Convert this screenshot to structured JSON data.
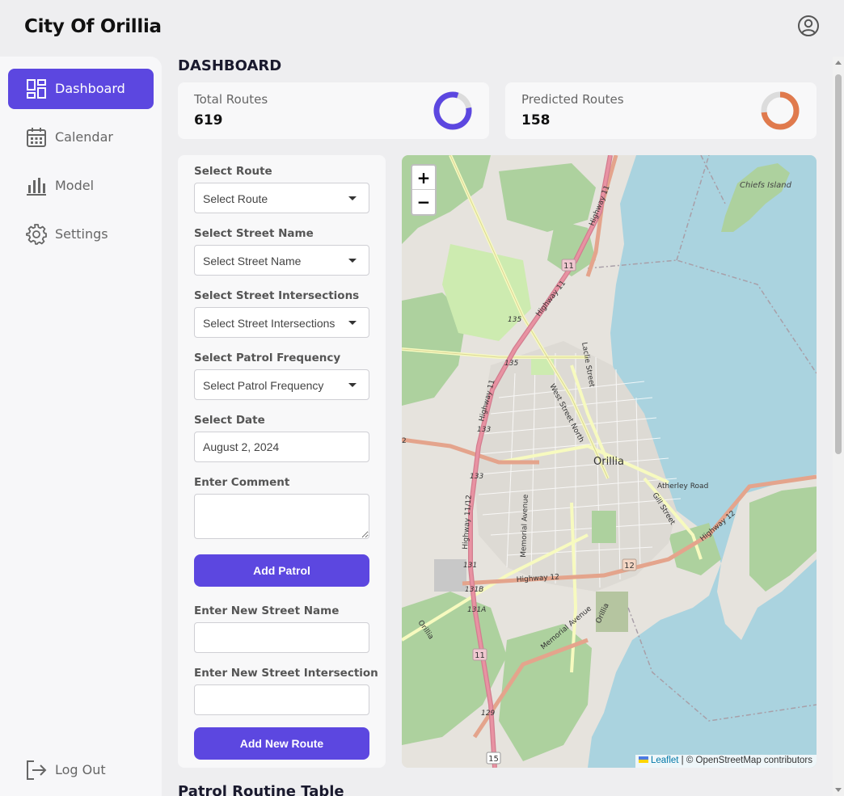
{
  "app": {
    "title": "City Of Orillia"
  },
  "header": {
    "profile_icon": "user-circle-icon"
  },
  "sidebar": {
    "items": [
      {
        "label": "Dashboard",
        "icon": "dashboard-icon",
        "active": true
      },
      {
        "label": "Calendar",
        "icon": "calendar-icon",
        "active": false
      },
      {
        "label": "Model",
        "icon": "bar-chart-icon",
        "active": false
      },
      {
        "label": "Settings",
        "icon": "gear-icon",
        "active": false
      }
    ],
    "logout": {
      "label": "Log Out",
      "icon": "logout-icon"
    }
  },
  "main": {
    "title": "DASHBOARD",
    "stats": [
      {
        "label": "Total Routes",
        "value": "619",
        "color": "#5c47e0"
      },
      {
        "label": "Predicted Routes",
        "value": "158",
        "color": "#e07a4d"
      }
    ],
    "form": {
      "route_label": "Select Route",
      "route_value": "Select Route",
      "street_label": "Select Street Name",
      "street_value": "Select Street Name",
      "intersection_label": "Select Street Intersections",
      "intersection_value": "Select Street Intersections",
      "frequency_label": "Select Patrol Frequency",
      "frequency_value": "Select Patrol Frequency",
      "date_label": "Select Date",
      "date_value": "August 2, 2024",
      "comment_label": "Enter Comment",
      "add_patrol_button": "Add Patrol",
      "new_street_label": "Enter New Street Name",
      "new_intersection_label": "Enter New Street Intersection",
      "add_route_button": "Add New Route"
    },
    "map": {
      "zoom_in": "+",
      "zoom_out": "−",
      "attribution_link": "Leaflet",
      "attribution_text": " | © OpenStreetMap contributors",
      "labels": {
        "city": "Orillia",
        "island": "Chiefs Island",
        "atherley": "Atherley Road",
        "gill": "Gill Street",
        "hwy12": "Highway 12",
        "hwy12b": "Highway 12",
        "hwy11": "Highway 11",
        "hwy11b": "Highway 11",
        "hwy11c": "Highway 11",
        "hwy1112": "Highway 11/12",
        "west_street": "West Street North",
        "laclie": "Laclie Street",
        "memorial": "Memorial Avenue",
        "memorial2": "Memorial Avenue",
        "orillia_small": "Orillia",
        "orillia_small2": "Orillia",
        "shield_11a": "11",
        "shield_11b": "11",
        "shield_12": "12",
        "shield_15": "15",
        "exit_135a": "135",
        "exit_135b": "135",
        "exit_133a": "133",
        "exit_133b": "133",
        "exit_131": "131",
        "exit_131b": "131B",
        "exit_131a": "131A",
        "exit_129": "129",
        "edge_2": "2"
      }
    },
    "table_title": "Patrol Routine Table"
  },
  "colors": {
    "accent": "#5c47e0",
    "secondary": "#e07a4d",
    "water": "#aad3df",
    "forest": "#add19e",
    "highway": "#e892a2"
  }
}
